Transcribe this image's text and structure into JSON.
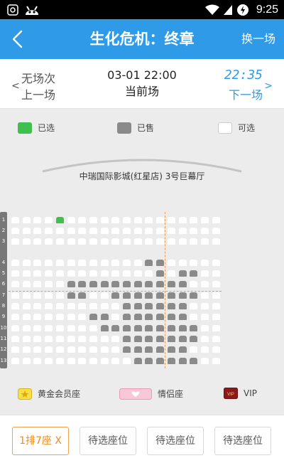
{
  "status_bar": {
    "time": "9:25",
    "icons": [
      "settings-icon",
      "android-icon",
      "wifi-icon",
      "signal-icon",
      "battery-icon"
    ]
  },
  "header": {
    "title": "生化危机：终章",
    "switch_label": "换一场"
  },
  "sessions": {
    "previous": {
      "line1": "无场次",
      "line2": "上一场"
    },
    "current": {
      "time": "03-01 22:00",
      "label": "当前场"
    },
    "next": {
      "time": "22:35",
      "label": "下一场"
    }
  },
  "legend": {
    "selected": "已选",
    "sold": "已售",
    "available": "可选"
  },
  "hall_name": "中瑞国际影城(红星店) 3号巨幕厅",
  "row_labels": [
    "1",
    "2",
    "3",
    "4",
    "5",
    "6",
    "7",
    "8",
    "9",
    "10",
    "11",
    "12",
    "13"
  ],
  "seat_types": {
    "gold": "黄金会员座",
    "couple": "情侣座",
    "vip": "VIP",
    "vip_badge": "VIP"
  },
  "selection_slots": [
    "1排7座 X",
    "待选座位",
    "待选座位",
    "待选座位"
  ],
  "colors": {
    "primary": "#2e9ae8",
    "selected": "#3fbf4d",
    "sold": "#8a8a8a",
    "accent": "#f08a1a"
  }
}
